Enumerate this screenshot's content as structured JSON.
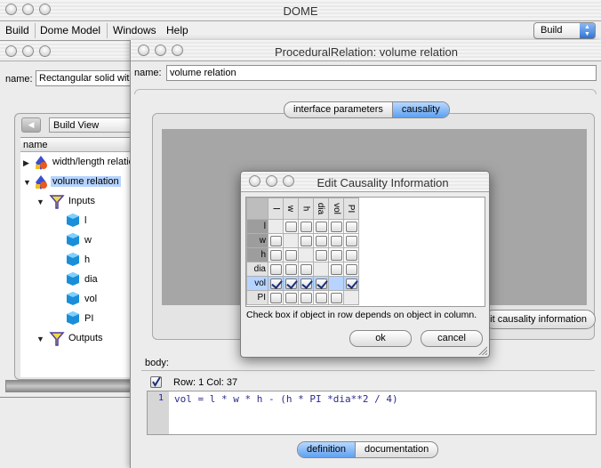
{
  "app": {
    "title": "DOME",
    "menus": [
      "Build",
      "Dome Model",
      "Windows",
      "Help"
    ],
    "mode_select": "Build"
  },
  "model_window": {
    "name_label": "name:",
    "name_value": "Rectangular solid with hole",
    "view_select": "Build View",
    "tree_header": "name",
    "tree": [
      {
        "label": "width/length relation",
        "kind": "relation"
      },
      {
        "label": "volume relation",
        "kind": "relation",
        "selected": true
      },
      {
        "label": "Inputs",
        "kind": "folder"
      },
      {
        "label": "l",
        "kind": "param"
      },
      {
        "label": "w",
        "kind": "param"
      },
      {
        "label": "h",
        "kind": "param"
      },
      {
        "label": "dia",
        "kind": "param"
      },
      {
        "label": "vol",
        "kind": "param"
      },
      {
        "label": "PI",
        "kind": "param"
      },
      {
        "label": "Outputs",
        "kind": "folder"
      }
    ]
  },
  "relation_window": {
    "title": "ProceduralRelation: volume relation",
    "name_label": "name:",
    "name_value": "volume relation",
    "top_tabs": [
      "interface parameters",
      "causality"
    ],
    "active_top_tab": "causality",
    "edit_button": "Edit causality information",
    "body_label": "body:",
    "row_col": "Row: 1 Col: 37",
    "code_line_number": "1",
    "code": "vol = l * w * h - (h * PI *dia**2 / 4)",
    "bottom_tabs": [
      "definition",
      "documentation"
    ],
    "active_bottom_tab": "definition"
  },
  "causality_dialog": {
    "title": "Edit Causality Information",
    "columns": [
      "l",
      "w",
      "h",
      "dia",
      "vol",
      "PI"
    ],
    "rows": [
      {
        "label": "l",
        "checks": [
          null,
          false,
          false,
          false,
          false,
          false
        ]
      },
      {
        "label": "w",
        "checks": [
          false,
          null,
          false,
          false,
          false,
          false
        ]
      },
      {
        "label": "h",
        "checks": [
          false,
          false,
          null,
          false,
          false,
          false
        ]
      },
      {
        "label": "dia",
        "checks": [
          false,
          false,
          false,
          null,
          false,
          false
        ]
      },
      {
        "label": "vol",
        "checks": [
          true,
          true,
          true,
          true,
          null,
          true
        ]
      },
      {
        "label": "PI",
        "checks": [
          false,
          false,
          false,
          false,
          false,
          null
        ]
      }
    ],
    "hint": "Check box if object in row depends on object in column.",
    "ok": "ok",
    "cancel": "cancel"
  }
}
